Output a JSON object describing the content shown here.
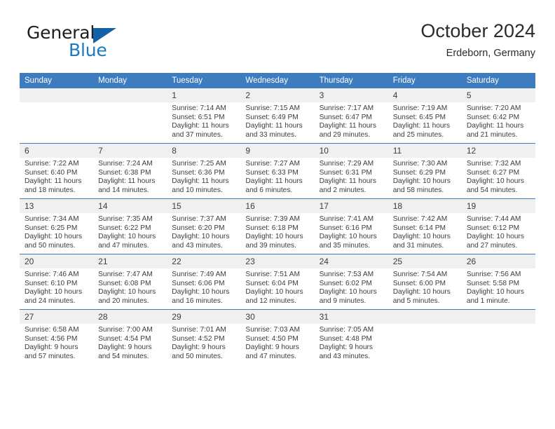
{
  "logo": {
    "text_top": "General",
    "text_bottom": "Blue",
    "triangle_color": "#1361a8",
    "blue_color": "#1c7ac0",
    "icon": "triangle-logo-mark"
  },
  "header": {
    "title": "October 2024",
    "subtitle": "Erdeborn, Germany"
  },
  "theme": {
    "header_blue": "#3d7cbf",
    "daynum_strip": "#f0f0f0",
    "text": "#3c3c3c"
  },
  "calendar": {
    "weekday_headers": [
      "Sunday",
      "Monday",
      "Tuesday",
      "Wednesday",
      "Thursday",
      "Friday",
      "Saturday"
    ],
    "labels": {
      "sunrise": "Sunrise:",
      "sunset": "Sunset:",
      "daylight": "Daylight:"
    },
    "weeks": [
      [
        {
          "day": "",
          "sunrise": "",
          "sunset": "",
          "daylight_line1": "",
          "daylight_line2": ""
        },
        {
          "day": "",
          "sunrise": "",
          "sunset": "",
          "daylight_line1": "",
          "daylight_line2": ""
        },
        {
          "day": "1",
          "sunrise": "Sunrise: 7:14 AM",
          "sunset": "Sunset: 6:51 PM",
          "daylight_line1": "Daylight: 11 hours",
          "daylight_line2": "and 37 minutes."
        },
        {
          "day": "2",
          "sunrise": "Sunrise: 7:15 AM",
          "sunset": "Sunset: 6:49 PM",
          "daylight_line1": "Daylight: 11 hours",
          "daylight_line2": "and 33 minutes."
        },
        {
          "day": "3",
          "sunrise": "Sunrise: 7:17 AM",
          "sunset": "Sunset: 6:47 PM",
          "daylight_line1": "Daylight: 11 hours",
          "daylight_line2": "and 29 minutes."
        },
        {
          "day": "4",
          "sunrise": "Sunrise: 7:19 AM",
          "sunset": "Sunset: 6:45 PM",
          "daylight_line1": "Daylight: 11 hours",
          "daylight_line2": "and 25 minutes."
        },
        {
          "day": "5",
          "sunrise": "Sunrise: 7:20 AM",
          "sunset": "Sunset: 6:42 PM",
          "daylight_line1": "Daylight: 11 hours",
          "daylight_line2": "and 21 minutes."
        }
      ],
      [
        {
          "day": "6",
          "sunrise": "Sunrise: 7:22 AM",
          "sunset": "Sunset: 6:40 PM",
          "daylight_line1": "Daylight: 11 hours",
          "daylight_line2": "and 18 minutes."
        },
        {
          "day": "7",
          "sunrise": "Sunrise: 7:24 AM",
          "sunset": "Sunset: 6:38 PM",
          "daylight_line1": "Daylight: 11 hours",
          "daylight_line2": "and 14 minutes."
        },
        {
          "day": "8",
          "sunrise": "Sunrise: 7:25 AM",
          "sunset": "Sunset: 6:36 PM",
          "daylight_line1": "Daylight: 11 hours",
          "daylight_line2": "and 10 minutes."
        },
        {
          "day": "9",
          "sunrise": "Sunrise: 7:27 AM",
          "sunset": "Sunset: 6:33 PM",
          "daylight_line1": "Daylight: 11 hours",
          "daylight_line2": "and 6 minutes."
        },
        {
          "day": "10",
          "sunrise": "Sunrise: 7:29 AM",
          "sunset": "Sunset: 6:31 PM",
          "daylight_line1": "Daylight: 11 hours",
          "daylight_line2": "and 2 minutes."
        },
        {
          "day": "11",
          "sunrise": "Sunrise: 7:30 AM",
          "sunset": "Sunset: 6:29 PM",
          "daylight_line1": "Daylight: 10 hours",
          "daylight_line2": "and 58 minutes."
        },
        {
          "day": "12",
          "sunrise": "Sunrise: 7:32 AM",
          "sunset": "Sunset: 6:27 PM",
          "daylight_line1": "Daylight: 10 hours",
          "daylight_line2": "and 54 minutes."
        }
      ],
      [
        {
          "day": "13",
          "sunrise": "Sunrise: 7:34 AM",
          "sunset": "Sunset: 6:25 PM",
          "daylight_line1": "Daylight: 10 hours",
          "daylight_line2": "and 50 minutes."
        },
        {
          "day": "14",
          "sunrise": "Sunrise: 7:35 AM",
          "sunset": "Sunset: 6:22 PM",
          "daylight_line1": "Daylight: 10 hours",
          "daylight_line2": "and 47 minutes."
        },
        {
          "day": "15",
          "sunrise": "Sunrise: 7:37 AM",
          "sunset": "Sunset: 6:20 PM",
          "daylight_line1": "Daylight: 10 hours",
          "daylight_line2": "and 43 minutes."
        },
        {
          "day": "16",
          "sunrise": "Sunrise: 7:39 AM",
          "sunset": "Sunset: 6:18 PM",
          "daylight_line1": "Daylight: 10 hours",
          "daylight_line2": "and 39 minutes."
        },
        {
          "day": "17",
          "sunrise": "Sunrise: 7:41 AM",
          "sunset": "Sunset: 6:16 PM",
          "daylight_line1": "Daylight: 10 hours",
          "daylight_line2": "and 35 minutes."
        },
        {
          "day": "18",
          "sunrise": "Sunrise: 7:42 AM",
          "sunset": "Sunset: 6:14 PM",
          "daylight_line1": "Daylight: 10 hours",
          "daylight_line2": "and 31 minutes."
        },
        {
          "day": "19",
          "sunrise": "Sunrise: 7:44 AM",
          "sunset": "Sunset: 6:12 PM",
          "daylight_line1": "Daylight: 10 hours",
          "daylight_line2": "and 27 minutes."
        }
      ],
      [
        {
          "day": "20",
          "sunrise": "Sunrise: 7:46 AM",
          "sunset": "Sunset: 6:10 PM",
          "daylight_line1": "Daylight: 10 hours",
          "daylight_line2": "and 24 minutes."
        },
        {
          "day": "21",
          "sunrise": "Sunrise: 7:47 AM",
          "sunset": "Sunset: 6:08 PM",
          "daylight_line1": "Daylight: 10 hours",
          "daylight_line2": "and 20 minutes."
        },
        {
          "day": "22",
          "sunrise": "Sunrise: 7:49 AM",
          "sunset": "Sunset: 6:06 PM",
          "daylight_line1": "Daylight: 10 hours",
          "daylight_line2": "and 16 minutes."
        },
        {
          "day": "23",
          "sunrise": "Sunrise: 7:51 AM",
          "sunset": "Sunset: 6:04 PM",
          "daylight_line1": "Daylight: 10 hours",
          "daylight_line2": "and 12 minutes."
        },
        {
          "day": "24",
          "sunrise": "Sunrise: 7:53 AM",
          "sunset": "Sunset: 6:02 PM",
          "daylight_line1": "Daylight: 10 hours",
          "daylight_line2": "and 9 minutes."
        },
        {
          "day": "25",
          "sunrise": "Sunrise: 7:54 AM",
          "sunset": "Sunset: 6:00 PM",
          "daylight_line1": "Daylight: 10 hours",
          "daylight_line2": "and 5 minutes."
        },
        {
          "day": "26",
          "sunrise": "Sunrise: 7:56 AM",
          "sunset": "Sunset: 5:58 PM",
          "daylight_line1": "Daylight: 10 hours",
          "daylight_line2": "and 1 minute."
        }
      ],
      [
        {
          "day": "27",
          "sunrise": "Sunrise: 6:58 AM",
          "sunset": "Sunset: 4:56 PM",
          "daylight_line1": "Daylight: 9 hours",
          "daylight_line2": "and 57 minutes."
        },
        {
          "day": "28",
          "sunrise": "Sunrise: 7:00 AM",
          "sunset": "Sunset: 4:54 PM",
          "daylight_line1": "Daylight: 9 hours",
          "daylight_line2": "and 54 minutes."
        },
        {
          "day": "29",
          "sunrise": "Sunrise: 7:01 AM",
          "sunset": "Sunset: 4:52 PM",
          "daylight_line1": "Daylight: 9 hours",
          "daylight_line2": "and 50 minutes."
        },
        {
          "day": "30",
          "sunrise": "Sunrise: 7:03 AM",
          "sunset": "Sunset: 4:50 PM",
          "daylight_line1": "Daylight: 9 hours",
          "daylight_line2": "and 47 minutes."
        },
        {
          "day": "31",
          "sunrise": "Sunrise: 7:05 AM",
          "sunset": "Sunset: 4:48 PM",
          "daylight_line1": "Daylight: 9 hours",
          "daylight_line2": "and 43 minutes."
        },
        {
          "day": "",
          "sunrise": "",
          "sunset": "",
          "daylight_line1": "",
          "daylight_line2": ""
        },
        {
          "day": "",
          "sunrise": "",
          "sunset": "",
          "daylight_line1": "",
          "daylight_line2": ""
        }
      ]
    ]
  }
}
